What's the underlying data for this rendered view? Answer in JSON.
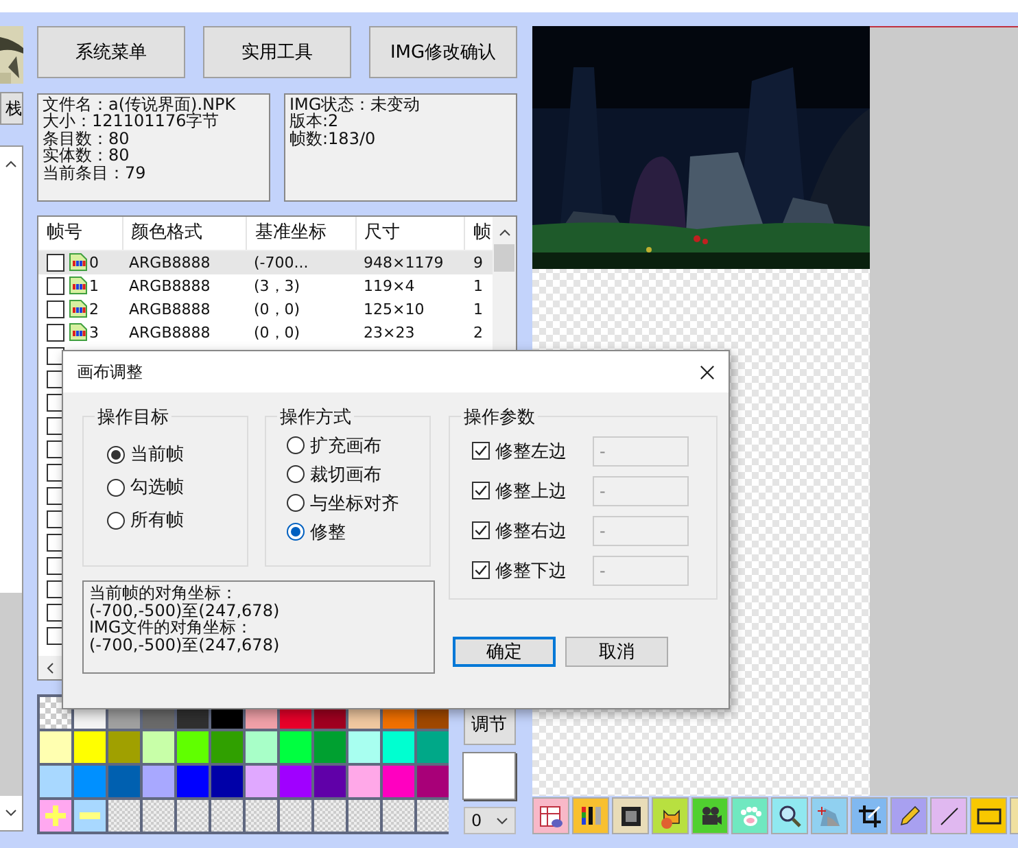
{
  "sidebar": {
    "side_button": {
      "label": "栈"
    }
  },
  "top_buttons": [
    {
      "label": "系统菜单"
    },
    {
      "label": "实用工具"
    },
    {
      "label": "IMG修改确认"
    }
  ],
  "file_info": {
    "lines": [
      "文件名：a(传说界面).NPK",
      "大小：121101176字节",
      "条目数：80",
      "实体数：80",
      "当前条目：79"
    ]
  },
  "img_info": {
    "lines": [
      "IMG状态：未变动",
      "版本:2",
      "帧数:183/0"
    ]
  },
  "frame_table": {
    "columns": [
      "帧号",
      "颜色格式",
      "基准坐标",
      "尺寸",
      "帧"
    ],
    "rows": [
      {
        "checked": false,
        "selected": true,
        "cells": [
          "0",
          "ARGB8888",
          "(-700...",
          "948×1179",
          "9"
        ]
      },
      {
        "checked": false,
        "selected": false,
        "cells": [
          "1",
          "ARGB8888",
          "(3，3)",
          "119×4",
          "1"
        ]
      },
      {
        "checked": false,
        "selected": false,
        "cells": [
          "2",
          "ARGB8888",
          "(0，0)",
          "125×10",
          "1"
        ]
      },
      {
        "checked": false,
        "selected": false,
        "cells": [
          "3",
          "ARGB8888",
          "(0，0)",
          "23×23",
          "2"
        ]
      },
      {
        "checked": false,
        "selected": false
      },
      {
        "checked": false,
        "selected": false
      },
      {
        "checked": false,
        "selected": false
      },
      {
        "checked": false,
        "selected": false
      },
      {
        "checked": false,
        "selected": false
      },
      {
        "checked": false,
        "selected": false
      },
      {
        "checked": false,
        "selected": false
      },
      {
        "checked": false,
        "selected": false
      },
      {
        "checked": false,
        "selected": false
      },
      {
        "checked": false,
        "selected": false
      },
      {
        "checked": false,
        "selected": false
      },
      {
        "checked": false,
        "selected": false
      },
      {
        "checked": false,
        "selected": false
      }
    ]
  },
  "palette": {
    "swatches": [
      {
        "kind": "transparent"
      },
      {
        "kind": "color",
        "color": "#f4f4f4"
      },
      {
        "kind": "color",
        "color": "#a0a0a0"
      },
      {
        "kind": "color",
        "color": "#6a6a6a"
      },
      {
        "kind": "color",
        "color": "#303030"
      },
      {
        "kind": "color",
        "color": "#000000"
      },
      {
        "kind": "color",
        "color": "#f0a0a8"
      },
      {
        "kind": "color",
        "color": "#e8002a"
      },
      {
        "kind": "color",
        "color": "#a00020"
      },
      {
        "kind": "color",
        "color": "#f0c8a0"
      },
      {
        "kind": "color",
        "color": "#f07000"
      },
      {
        "kind": "color",
        "color": "#a04800"
      },
      {
        "kind": "color",
        "color": "#ffffb0"
      },
      {
        "kind": "color",
        "color": "#ffff00"
      },
      {
        "kind": "color",
        "color": "#a0a000"
      },
      {
        "kind": "color",
        "color": "#c8ffa8"
      },
      {
        "kind": "color",
        "color": "#60ff00"
      },
      {
        "kind": "color",
        "color": "#30a000"
      },
      {
        "kind": "color",
        "color": "#a8ffc8"
      },
      {
        "kind": "color",
        "color": "#00ff40"
      },
      {
        "kind": "color",
        "color": "#00a030"
      },
      {
        "kind": "color",
        "color": "#a8fff0"
      },
      {
        "kind": "color",
        "color": "#00ffd0"
      },
      {
        "kind": "color",
        "color": "#00a888"
      },
      {
        "kind": "color",
        "color": "#a8d8ff"
      },
      {
        "kind": "color",
        "color": "#0090ff"
      },
      {
        "kind": "color",
        "color": "#0060b0"
      },
      {
        "kind": "color",
        "color": "#a8a8ff"
      },
      {
        "kind": "color",
        "color": "#0000ff"
      },
      {
        "kind": "color",
        "color": "#0000a8"
      },
      {
        "kind": "color",
        "color": "#e0a8ff"
      },
      {
        "kind": "color",
        "color": "#a000ff"
      },
      {
        "kind": "color",
        "color": "#6000a8"
      },
      {
        "kind": "color",
        "color": "#ffa8e8"
      },
      {
        "kind": "color",
        "color": "#ff00c0"
      },
      {
        "kind": "color",
        "color": "#a80078"
      },
      {
        "kind": "add"
      },
      {
        "kind": "remove"
      },
      {
        "kind": "empty"
      },
      {
        "kind": "empty"
      },
      {
        "kind": "empty"
      },
      {
        "kind": "empty"
      },
      {
        "kind": "empty"
      },
      {
        "kind": "empty"
      },
      {
        "kind": "empty"
      },
      {
        "kind": "empty"
      },
      {
        "kind": "empty"
      },
      {
        "kind": "empty"
      }
    ]
  },
  "adjust_button": {
    "label": "调节"
  },
  "current_color": {
    "color": "#ffffff"
  },
  "index_select": {
    "value": "0"
  },
  "dialog": {
    "title": "画布调整",
    "target": {
      "title": "操作目标",
      "options": [
        {
          "label": "当前帧",
          "selected": true
        },
        {
          "label": "勾选帧",
          "selected": false
        },
        {
          "label": "所有帧",
          "selected": false
        }
      ]
    },
    "mode": {
      "title": "操作方式",
      "options": [
        {
          "label": "扩充画布",
          "selected": false
        },
        {
          "label": "裁切画布",
          "selected": false
        },
        {
          "label": "与坐标对齐",
          "selected": false
        },
        {
          "label": "修整",
          "selected": true
        }
      ]
    },
    "params": {
      "title": "操作参数",
      "items": [
        {
          "label": "修整左边",
          "checked": true,
          "value": "-",
          "disabled": true
        },
        {
          "label": "修整上边",
          "checked": true,
          "value": "-",
          "disabled": true
        },
        {
          "label": "修整右边",
          "checked": true,
          "value": "-",
          "disabled": true
        },
        {
          "label": "修整下边",
          "checked": true,
          "value": "-",
          "disabled": true
        }
      ]
    },
    "info_lines": [
      "当前帧的对角坐标：",
      "(-700,-500)至(247,678)",
      "IMG文件的对角坐标：",
      "(-700,-500)至(247,678)"
    ],
    "buttons": [
      {
        "label": "确定",
        "default": true
      },
      {
        "label": "取消",
        "default": false
      }
    ]
  }
}
